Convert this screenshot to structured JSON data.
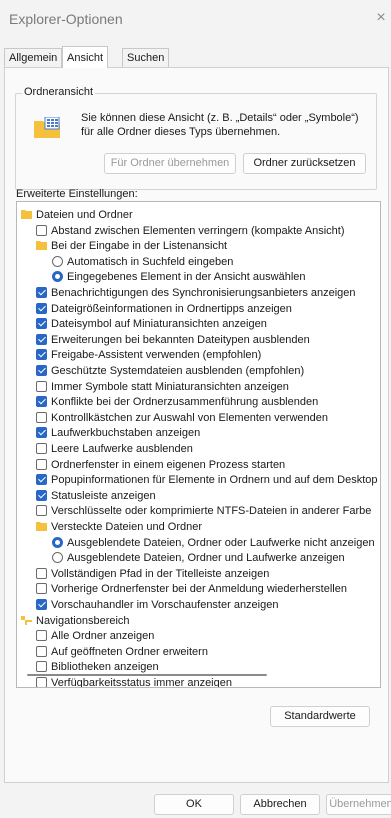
{
  "window": {
    "title": "Explorer-Optionen",
    "close_glyph": "×"
  },
  "tabs": [
    {
      "label": "Allgemein",
      "active": false
    },
    {
      "label": "Ansicht",
      "active": true
    },
    {
      "label": "Suchen",
      "active": false
    }
  ],
  "folder_view": {
    "group_label": "Ordneransicht",
    "description": "Sie können diese Ansicht (z. B. „Details“ oder „Symbole“) für alle Ordner dieses Typs übernehmen.",
    "apply_button": "Für Ordner übernehmen",
    "reset_button": "Ordner zurücksetzen"
  },
  "advanced": {
    "label": "Erweiterte Einstellungen:",
    "items": [
      {
        "type": "folder",
        "level": 0,
        "label": "Dateien und Ordner"
      },
      {
        "type": "checkbox",
        "level": 1,
        "checked": false,
        "label": "Abstand zwischen Elementen verringern (kompakte Ansicht)"
      },
      {
        "type": "folder",
        "level": 1,
        "label": "Bei der Eingabe in der Listenansicht"
      },
      {
        "type": "radio",
        "level": 2,
        "checked": false,
        "label": "Automatisch in Suchfeld eingeben"
      },
      {
        "type": "radio",
        "level": 2,
        "checked": true,
        "label": "Eingegebenes Element in der Ansicht auswählen"
      },
      {
        "type": "checkbox",
        "level": 1,
        "checked": true,
        "label": "Benachrichtigungen des Synchronisierungsanbieters anzeigen"
      },
      {
        "type": "checkbox",
        "level": 1,
        "checked": true,
        "label": "Dateigrößeinformationen in Ordnertipps anzeigen"
      },
      {
        "type": "checkbox",
        "level": 1,
        "checked": true,
        "label": "Dateisymbol auf Miniaturansichten anzeigen"
      },
      {
        "type": "checkbox",
        "level": 1,
        "checked": true,
        "label": "Erweiterungen bei bekannten Dateitypen ausblenden"
      },
      {
        "type": "checkbox",
        "level": 1,
        "checked": true,
        "label": "Freigabe-Assistent verwenden (empfohlen)"
      },
      {
        "type": "checkbox",
        "level": 1,
        "checked": true,
        "label": "Geschützte Systemdateien ausblenden (empfohlen)"
      },
      {
        "type": "checkbox",
        "level": 1,
        "checked": false,
        "label": "Immer Symbole statt Miniaturansichten anzeigen"
      },
      {
        "type": "checkbox",
        "level": 1,
        "checked": true,
        "label": "Konflikte bei der Ordnerzusammenführung ausblenden"
      },
      {
        "type": "checkbox",
        "level": 1,
        "checked": false,
        "label": "Kontrollkästchen zur Auswahl von Elementen verwenden"
      },
      {
        "type": "checkbox",
        "level": 1,
        "checked": true,
        "label": "Laufwerkbuchstaben anzeigen"
      },
      {
        "type": "checkbox",
        "level": 1,
        "checked": false,
        "label": "Leere Laufwerke ausblenden"
      },
      {
        "type": "checkbox",
        "level": 1,
        "checked": false,
        "label": "Ordnerfenster in einem eigenen Prozess starten"
      },
      {
        "type": "checkbox",
        "level": 1,
        "checked": true,
        "label": "Popupinformationen für Elemente in Ordnern und auf dem Desktop"
      },
      {
        "type": "checkbox",
        "level": 1,
        "checked": true,
        "label": "Statusleiste anzeigen"
      },
      {
        "type": "checkbox",
        "level": 1,
        "checked": false,
        "label": "Verschlüsselte oder komprimierte NTFS-Dateien in anderer Farbe"
      },
      {
        "type": "folder",
        "level": 1,
        "label": "Versteckte Dateien und Ordner"
      },
      {
        "type": "radio",
        "level": 2,
        "checked": true,
        "label": "Ausgeblendete Dateien, Ordner oder Laufwerke nicht anzeigen"
      },
      {
        "type": "radio",
        "level": 2,
        "checked": false,
        "label": "Ausgeblendete Dateien, Ordner und Laufwerke anzeigen"
      },
      {
        "type": "checkbox",
        "level": 1,
        "checked": false,
        "label": "Vollständigen Pfad in der Titelleiste anzeigen"
      },
      {
        "type": "checkbox",
        "level": 1,
        "checked": false,
        "label": "Vorherige Ordnerfenster bei der Anmeldung wiederherstellen"
      },
      {
        "type": "checkbox",
        "level": 1,
        "checked": true,
        "label": "Vorschauhandler im Vorschaufenster anzeigen"
      },
      {
        "type": "navfolder",
        "level": 0,
        "label": "Navigationsbereich"
      },
      {
        "type": "checkbox",
        "level": 1,
        "checked": false,
        "label": "Alle Ordner anzeigen"
      },
      {
        "type": "checkbox",
        "level": 1,
        "checked": false,
        "label": "Auf geöffneten Ordner erweitern"
      },
      {
        "type": "checkbox",
        "level": 1,
        "checked": false,
        "label": "Bibliotheken anzeigen"
      },
      {
        "type": "checkbox",
        "level": 1,
        "checked": false,
        "label": "Verfügbarkeitsstatus immer anzeigen"
      }
    ],
    "defaults_button": "Standardwerte"
  },
  "footer": {
    "ok": "OK",
    "cancel": "Abbrechen",
    "apply": "Übernehmen"
  },
  "colors": {
    "accent": "#2867c5",
    "folder": "#f5c03b"
  }
}
